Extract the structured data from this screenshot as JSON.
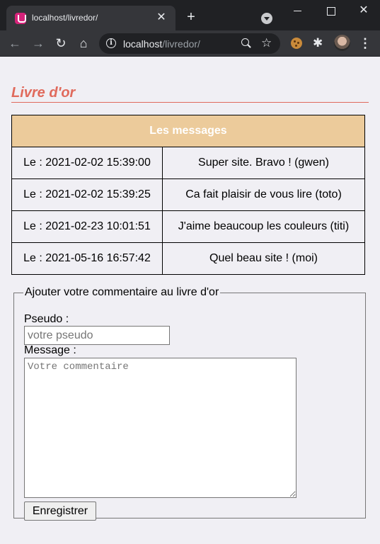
{
  "browser": {
    "tab_title": "localhost/livredor/",
    "url_host": "localhost",
    "url_path": "/livredor/"
  },
  "page": {
    "title": "Livre d'or",
    "title_color": "#e06a5c"
  },
  "messages_table": {
    "header": "Les messages",
    "header_bg": "#eccb9b",
    "rows": [
      {
        "date": "Le : 2021-02-02 15:39:00",
        "message": "Super site. Bravo ! (gwen)"
      },
      {
        "date": "Le : 2021-02-02 15:39:25",
        "message": "Ca fait plaisir de vous lire (toto)"
      },
      {
        "date": "Le : 2021-02-23 10:01:51",
        "message": "J'aime beaucoup les couleurs (titi)"
      },
      {
        "date": "Le : 2021-05-16 16:57:42",
        "message": "Quel beau site ! (moi)"
      }
    ]
  },
  "form": {
    "legend": "Ajouter votre commentaire au livre d'or",
    "pseudo_label": "Pseudo :",
    "pseudo_placeholder": "votre pseudo",
    "message_label": "Message :",
    "message_placeholder": "Votre commentaire",
    "submit_label": "Enregistrer"
  }
}
